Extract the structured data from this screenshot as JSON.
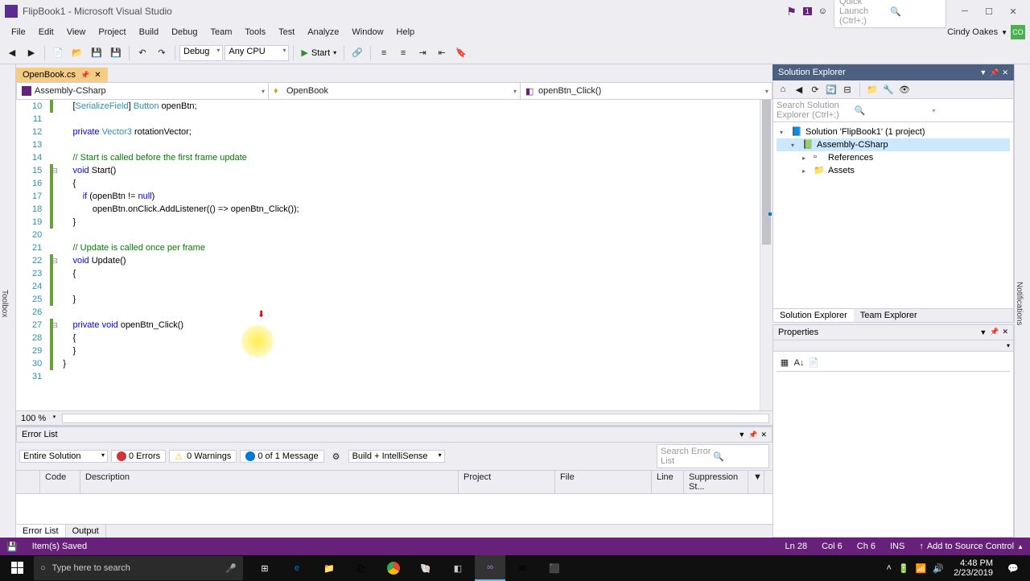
{
  "window": {
    "title": "FlipBook1 - Microsoft Visual Studio",
    "quick_launch_placeholder": "Quick Launch (Ctrl+;)",
    "flag_badge": "1"
  },
  "menu": {
    "items": [
      "File",
      "Edit",
      "View",
      "Project",
      "Build",
      "Debug",
      "Team",
      "Tools",
      "Test",
      "Analyze",
      "Window",
      "Help"
    ],
    "user": "Cindy Oakes",
    "user_initials": "CO"
  },
  "toolbar": {
    "config": "Debug",
    "platform": "Any CPU",
    "start": "Start"
  },
  "editor": {
    "tab": "OpenBook.cs",
    "nav_scope": "Assembly-CSharp",
    "nav_class": "OpenBook",
    "nav_member": "openBtn_Click()",
    "zoom": "100 %",
    "first_line": 10,
    "lines": [
      {
        "raw": "    [SerializeField] Button openBtn;",
        "html": "    [<span class='type'>SerializeField</span>] <span class='type'>Button</span> openBtn;"
      },
      {
        "raw": "",
        "html": ""
      },
      {
        "raw": "    private Vector3 rotationVector;",
        "html": "    <span class='kw'>private</span> <span class='type'>Vector3</span> rotationVector;"
      },
      {
        "raw": "",
        "html": ""
      },
      {
        "raw": "    // Start is called before the first frame update",
        "html": "    <span class='cmnt'>// Start is called before the first frame update</span>"
      },
      {
        "raw": "    void Start()",
        "html": "    <span class='kw'>void</span> Start()",
        "fold": true
      },
      {
        "raw": "    {",
        "html": "    {"
      },
      {
        "raw": "        if (openBtn != null)",
        "html": "        <span class='kw'>if</span> (openBtn != <span class='kw'>null</span>)"
      },
      {
        "raw": "            openBtn.onClick.AddListener(() => openBtn_Click());",
        "html": "            openBtn.onClick.AddListener(() => openBtn_Click());"
      },
      {
        "raw": "    }",
        "html": "    }"
      },
      {
        "raw": "",
        "html": ""
      },
      {
        "raw": "    // Update is called once per frame",
        "html": "    <span class='cmnt'>// Update is called once per frame</span>"
      },
      {
        "raw": "    void Update()",
        "html": "    <span class='kw'>void</span> Update()",
        "fold": true
      },
      {
        "raw": "    {",
        "html": "    {"
      },
      {
        "raw": "",
        "html": ""
      },
      {
        "raw": "    }",
        "html": "    }"
      },
      {
        "raw": "",
        "html": ""
      },
      {
        "raw": "    private void openBtn_Click()",
        "html": "    <span class='kw'>private</span> <span class='kw'>void</span> openBtn_Click()",
        "fold": true
      },
      {
        "raw": "    {",
        "html": "    {"
      },
      {
        "raw": "    }",
        "html": "    }"
      },
      {
        "raw": "}",
        "html": "}"
      },
      {
        "raw": "",
        "html": ""
      }
    ]
  },
  "solution_explorer": {
    "title": "Solution Explorer",
    "search_placeholder": "Search Solution Explorer (Ctrl+;)",
    "nodes": [
      {
        "depth": 0,
        "icon": "solution",
        "label": "Solution 'FlipBook1' (1 project)",
        "exp": "▾"
      },
      {
        "depth": 1,
        "icon": "csproj",
        "label": "Assembly-CSharp",
        "exp": "▾",
        "sel": true
      },
      {
        "depth": 2,
        "icon": "refs",
        "label": "References",
        "exp": "▸"
      },
      {
        "depth": 2,
        "icon": "folder",
        "label": "Assets",
        "exp": "▸"
      }
    ],
    "tabs": [
      "Solution Explorer",
      "Team Explorer"
    ]
  },
  "properties": {
    "title": "Properties"
  },
  "error_list": {
    "title": "Error List",
    "scope": "Entire Solution",
    "errors": "0 Errors",
    "warnings": "0 Warnings",
    "messages": "0 of 1 Message",
    "build_filter": "Build + IntelliSense",
    "search_placeholder": "Search Error List",
    "columns": [
      "",
      "Code",
      "Description",
      "Project",
      "File",
      "Line",
      "Suppression St..."
    ],
    "tabs": [
      "Error List",
      "Output"
    ]
  },
  "status": {
    "msg": "Item(s) Saved",
    "line": "Ln 28",
    "col": "Col 6",
    "ch": "Ch 6",
    "ins": "INS",
    "add_src": "Add to Source Control"
  },
  "taskbar": {
    "search_placeholder": "Type here to search",
    "time": "4:48 PM",
    "date": "2/23/2019"
  },
  "colors": {
    "accent": "#68217a"
  }
}
